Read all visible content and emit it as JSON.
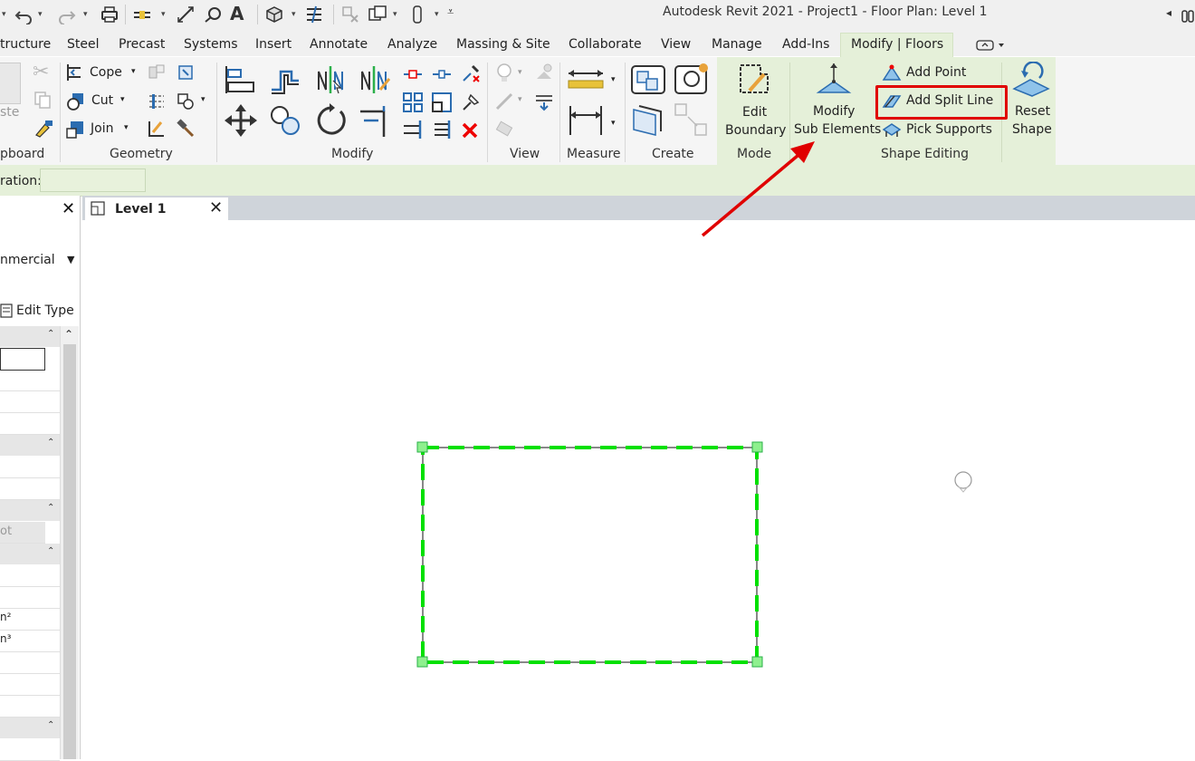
{
  "window": {
    "title": "Autodesk Revit 2021 - Project1 - Floor Plan: Level 1"
  },
  "tabs": [
    {
      "id": "structure",
      "label": "tructure"
    },
    {
      "id": "steel",
      "label": "Steel"
    },
    {
      "id": "precast",
      "label": "Precast"
    },
    {
      "id": "systems",
      "label": "Systems"
    },
    {
      "id": "insert",
      "label": "Insert"
    },
    {
      "id": "annotate",
      "label": "Annotate"
    },
    {
      "id": "analyze",
      "label": "Analyze"
    },
    {
      "id": "massing",
      "label": "Massing & Site"
    },
    {
      "id": "collaborate",
      "label": "Collaborate"
    },
    {
      "id": "view",
      "label": "View"
    },
    {
      "id": "manage",
      "label": "Manage"
    },
    {
      "id": "addins",
      "label": "Add-Ins"
    },
    {
      "id": "modify-floors",
      "label": "Modify | Floors"
    }
  ],
  "ribbon": {
    "clipboard": {
      "panel": "pboard",
      "paste": "ste"
    },
    "geometry": {
      "panel": "Geometry",
      "cope": "Cope",
      "cut": "Cut",
      "join": "Join"
    },
    "modify": {
      "panel": "Modify"
    },
    "view": {
      "panel": "View"
    },
    "measure": {
      "panel": "Measure"
    },
    "create": {
      "panel": "Create"
    },
    "mode": {
      "panel": "Mode",
      "edit_boundary_1": "Edit",
      "edit_boundary_2": "Boundary"
    },
    "shape_editing": {
      "panel": "Shape Editing",
      "modify_sub_1": "Modify",
      "modify_sub_2": "Sub Elements",
      "add_point": "Add Point",
      "add_split_line": "Add Split Line",
      "pick_supports": "Pick Supports",
      "reset_1": "Reset",
      "reset_2": "Shape"
    }
  },
  "options_bar": {
    "label": "ration:",
    "value": ""
  },
  "properties": {
    "type_name": "nmercial",
    "edit_type": "Edit Type",
    "row_value": "ot",
    "unit_area": "n²",
    "unit_volume": "n³"
  },
  "view_tab": {
    "label": "Level 1"
  },
  "colors": {
    "accent_green": "#00e000",
    "highlight_red": "#e00000",
    "ribbon_ctx": "#e5f0d9",
    "icon_blue": "#2b6cb0"
  }
}
